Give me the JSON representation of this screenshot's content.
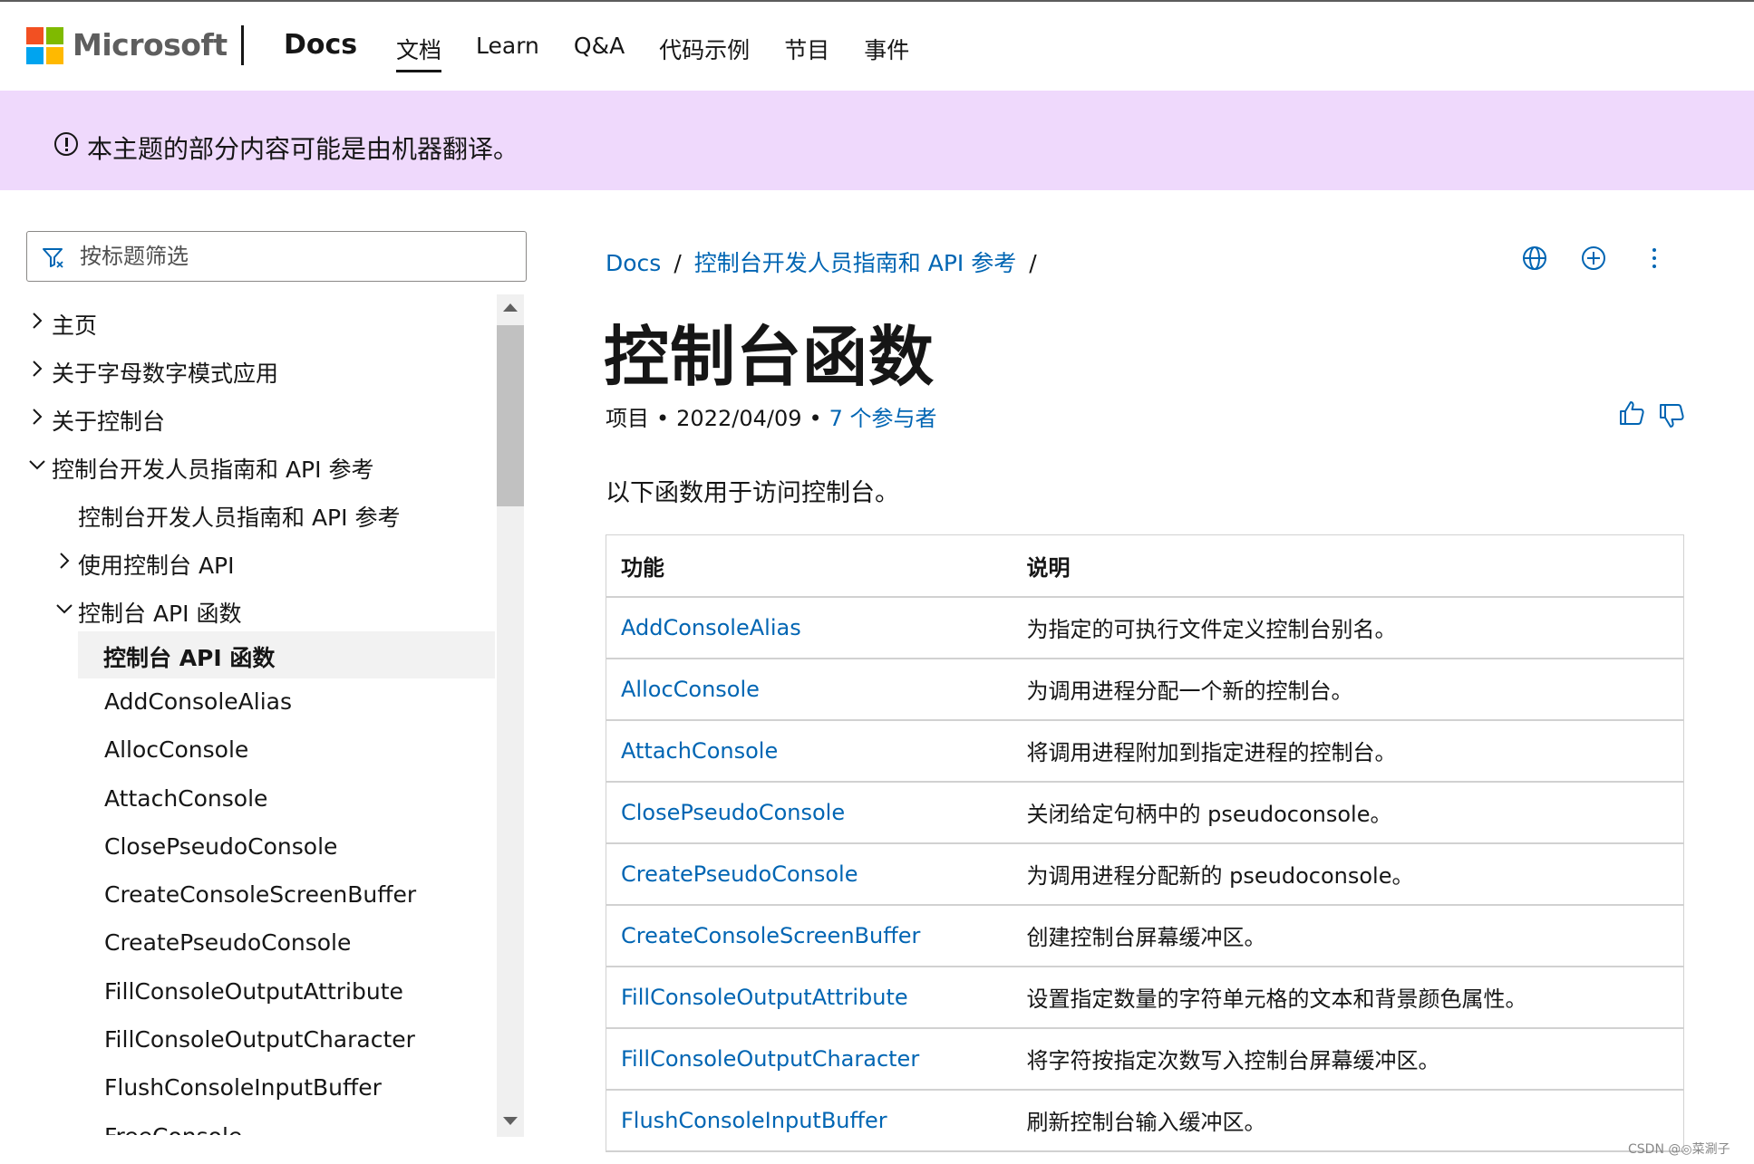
{
  "header": {
    "ms_text": "Microsoft",
    "docs_brand": "Docs",
    "nav": [
      "文档",
      "Learn",
      "Q&A",
      "代码示例",
      "节目",
      "事件"
    ]
  },
  "banner": {
    "text": "本主题的部分内容可能是由机器翻译。"
  },
  "sidebar": {
    "filter_placeholder": "按标题筛选",
    "items": [
      {
        "label": "主页",
        "chevron": "right",
        "level": 0
      },
      {
        "label": "关于字母数字模式应用",
        "chevron": "right",
        "level": 0
      },
      {
        "label": "关于控制台",
        "chevron": "right",
        "level": 0
      },
      {
        "label": "控制台开发人员指南和 API 参考",
        "chevron": "down",
        "level": 0
      },
      {
        "label": "控制台开发人员指南和 API 参考",
        "chevron": "none",
        "level": 1
      },
      {
        "label": "使用控制台 API",
        "chevron": "right",
        "level": 1
      },
      {
        "label": "控制台 API 函数",
        "chevron": "down",
        "level": 1
      },
      {
        "label": "控制台 API 函数",
        "chevron": "none",
        "level": 2,
        "selected": true
      },
      {
        "label": "AddConsoleAlias",
        "chevron": "none",
        "level": 2
      },
      {
        "label": "AllocConsole",
        "chevron": "none",
        "level": 2
      },
      {
        "label": "AttachConsole",
        "chevron": "none",
        "level": 2
      },
      {
        "label": "ClosePseudoConsole",
        "chevron": "none",
        "level": 2
      },
      {
        "label": "CreateConsoleScreenBuffer",
        "chevron": "none",
        "level": 2
      },
      {
        "label": "CreatePseudoConsole",
        "chevron": "none",
        "level": 2
      },
      {
        "label": "FillConsoleOutputAttribute",
        "chevron": "none",
        "level": 2
      },
      {
        "label": "FillConsoleOutputCharacter",
        "chevron": "none",
        "level": 2
      },
      {
        "label": "FlushConsoleInputBuffer",
        "chevron": "none",
        "level": 2
      },
      {
        "label": "FreeConsole",
        "chevron": "none",
        "level": 2
      }
    ]
  },
  "breadcrumb": {
    "items": [
      "Docs",
      "控制台开发人员指南和 API 参考"
    ],
    "separator": "/"
  },
  "article": {
    "title": "控制台函数",
    "meta_type": "项目",
    "meta_date": "2022/04/09",
    "meta_contributors": "7 个参与者",
    "intro": "以下函数用于访问控制台。",
    "table_headers": [
      "功能",
      "说明"
    ],
    "rows": [
      {
        "fn": "AddConsoleAlias",
        "desc": "为指定的可执行文件定义控制台别名。"
      },
      {
        "fn": "AllocConsole",
        "desc": "为调用进程分配一个新的控制台。"
      },
      {
        "fn": "AttachConsole",
        "desc": "将调用进程附加到指定进程的控制台。"
      },
      {
        "fn": "ClosePseudoConsole",
        "desc": "关闭给定句柄中的 pseudoconsole。"
      },
      {
        "fn": "CreatePseudoConsole",
        "desc": "为调用进程分配新的 pseudoconsole。"
      },
      {
        "fn": "CreateConsoleScreenBuffer",
        "desc": "创建控制台屏幕缓冲区。"
      },
      {
        "fn": "FillConsoleOutputAttribute",
        "desc": "设置指定数量的字符单元格的文本和背景颜色属性。"
      },
      {
        "fn": "FillConsoleOutputCharacter",
        "desc": "将字符按指定次数写入控制台屏幕缓冲区。"
      },
      {
        "fn": "FlushConsoleInputBuffer",
        "desc": "刷新控制台输入缓冲区。"
      }
    ]
  },
  "watermark": "CSDN @◎菜涮子",
  "colors": {
    "link": "#0065b3",
    "banner": "#efd9fc",
    "selected": "#f2f2f2"
  },
  "icons": [
    "globe-icon",
    "add-icon",
    "more-icon",
    "thumbs-up-icon",
    "thumbs-down-icon",
    "filter-icon",
    "info-icon"
  ]
}
